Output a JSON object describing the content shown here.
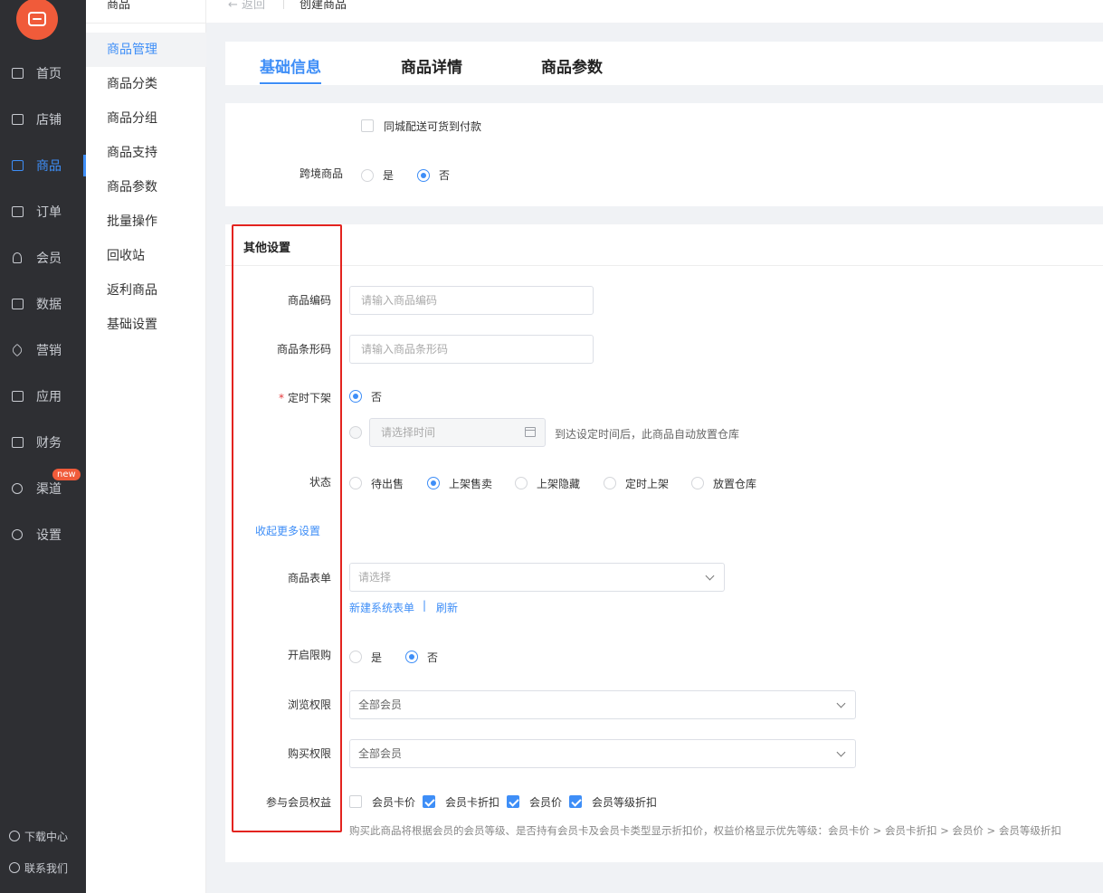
{
  "nav": {
    "items": [
      {
        "label": "首页",
        "icon": "home-icon"
      },
      {
        "label": "店铺",
        "icon": "shop-icon"
      },
      {
        "label": "商品",
        "icon": "goods-icon"
      },
      {
        "label": "订单",
        "icon": "order-icon"
      },
      {
        "label": "会员",
        "icon": "member-icon"
      },
      {
        "label": "数据",
        "icon": "chart-icon"
      },
      {
        "label": "营销",
        "icon": "tag-icon"
      },
      {
        "label": "应用",
        "icon": "app-icon"
      },
      {
        "label": "财务",
        "icon": "finance-icon"
      },
      {
        "label": "渠道",
        "icon": "channel-icon",
        "badge": "new"
      },
      {
        "label": "设置",
        "icon": "gear-icon"
      }
    ],
    "bottom": {
      "download": "下载中心",
      "contact": "联系我们"
    },
    "accent": "#3e8ef7",
    "logo_color": "#f05b3a"
  },
  "submenu": {
    "head": "商品",
    "items": [
      "商品管理",
      "商品分类",
      "商品分组",
      "商品支持",
      "商品参数",
      "批量操作",
      "回收站",
      "返利商品",
      "基础设置"
    ]
  },
  "topbar": {
    "back": "← 返回",
    "crumb": "创建商品"
  },
  "tabs": [
    "基础信息",
    "商品详情",
    "商品参数"
  ],
  "basic": {
    "cod_label": "同城配送可货到付款",
    "crossborder_label": "跨境商品",
    "yes": "是",
    "no": "否"
  },
  "other": {
    "title": "其他设置",
    "code_label": "商品编码",
    "code_placeholder": "请输入商品编码",
    "barcode_label": "商品条形码",
    "barcode_placeholder": "请输入商品条形码",
    "offshelf_required": "*",
    "offshelf_label": "定时下架",
    "offshelf_no": "否",
    "time_placeholder": "请选择时间",
    "time_hint": "到达设定时间后，此商品自动放置仓库",
    "status_label": "状态",
    "status_options": [
      "待出售",
      "上架售卖",
      "上架隐藏",
      "定时上架",
      "放置仓库"
    ],
    "collapse_link": "收起更多设置",
    "form_label": "商品表单",
    "form_placeholder": "请选择",
    "new_form_link": "新建系统表单",
    "link_sep": "|",
    "refresh_link": "刷新",
    "limit_label": "开启限购",
    "limit_yes": "是",
    "limit_no": "否",
    "browse_label": "浏览权限",
    "browse_value": "全部会员",
    "buy_label": "购买权限",
    "buy_value": "全部会员",
    "rights_label": "参与会员权益",
    "rights_options": [
      "会员卡价",
      "会员卡折扣",
      "会员价",
      "会员等级折扣"
    ],
    "rights_hint": "购买此商品将根据会员的会员等级、是否持有会员卡及会员卡类型显示折扣价，权益价格显示优先等级：会员卡价 > 会员卡折扣 > 会员价 > 会员等级折扣"
  }
}
